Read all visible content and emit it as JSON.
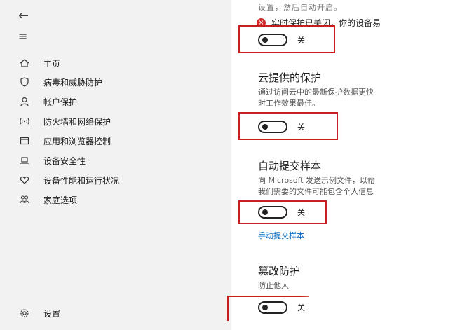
{
  "sidebar": {
    "back_icon": "back-arrow-icon",
    "menu_icon": "hamburger-icon",
    "items": [
      {
        "label": "主页",
        "icon": "home-icon"
      },
      {
        "label": "病毒和威胁防护",
        "icon": "shield-icon"
      },
      {
        "label": "帐户保护",
        "icon": "person-icon"
      },
      {
        "label": "防火墙和网络保护",
        "icon": "wifi-antenna-icon"
      },
      {
        "label": "应用和浏览器控制",
        "icon": "browser-window-icon"
      },
      {
        "label": "设备安全性",
        "icon": "laptop-icon"
      },
      {
        "label": "设备性能和运行状况",
        "icon": "heart-icon"
      },
      {
        "label": "家庭选项",
        "icon": "family-icon"
      }
    ],
    "settings_label": "设置"
  },
  "main": {
    "top_text": "设置，然后自动开启。",
    "warning_text": "实时保护已关闭，你的设备易",
    "realtime_toggle": {
      "state": "off",
      "label": "关"
    },
    "cloud": {
      "title": "云提供的保护",
      "desc_line1": "通过访问云中的最新保护数据更快",
      "desc_line2": "时工作效果最佳。",
      "toggle_label": "关"
    },
    "sample": {
      "title": "自动提交样本",
      "desc_line1": "向 Microsoft 发送示例文件，以帮",
      "desc_line2": "我们需要的文件可能包含个人信息",
      "toggle_label": "关",
      "link": "手动提交样本"
    },
    "tamper": {
      "title": "篡改防护",
      "desc_line1": "防止他人",
      "toggle_label": "关"
    }
  },
  "colors": {
    "accent_red": "#c81e1e",
    "link_blue": "#0067c0",
    "sidebar_bg": "#f2f2f2"
  }
}
